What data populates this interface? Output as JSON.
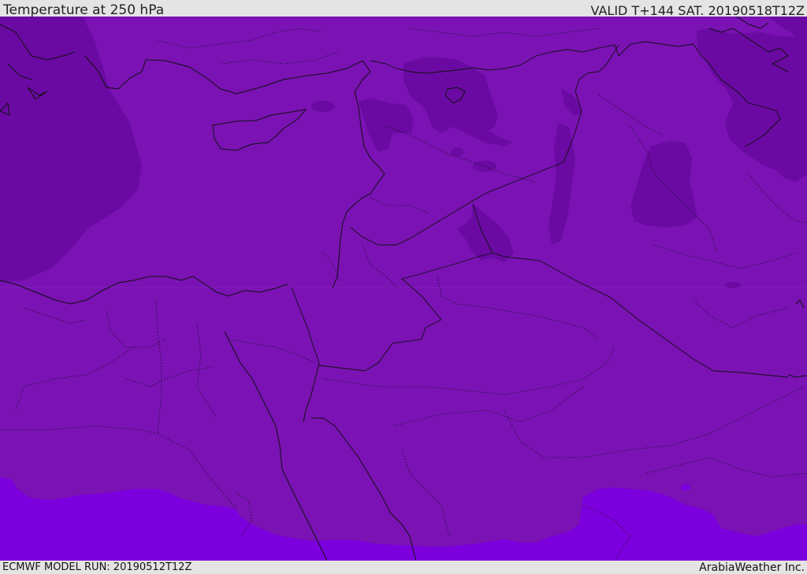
{
  "header": {
    "title": "Temperature at 250 hPa",
    "valid_time": "VALID T+144 SAT. 20190518T12Z"
  },
  "footer": {
    "model_run": "ECMWF MODEL RUN: 20190512T12Z",
    "credit": "ArabiaWeather Inc."
  },
  "map": {
    "colors": {
      "base_fill": "#7a12b4",
      "cold_fill": "#6a0aa2",
      "warm_fill": "#7c00dd",
      "coastline": "#111111",
      "border": "#111111"
    }
  }
}
